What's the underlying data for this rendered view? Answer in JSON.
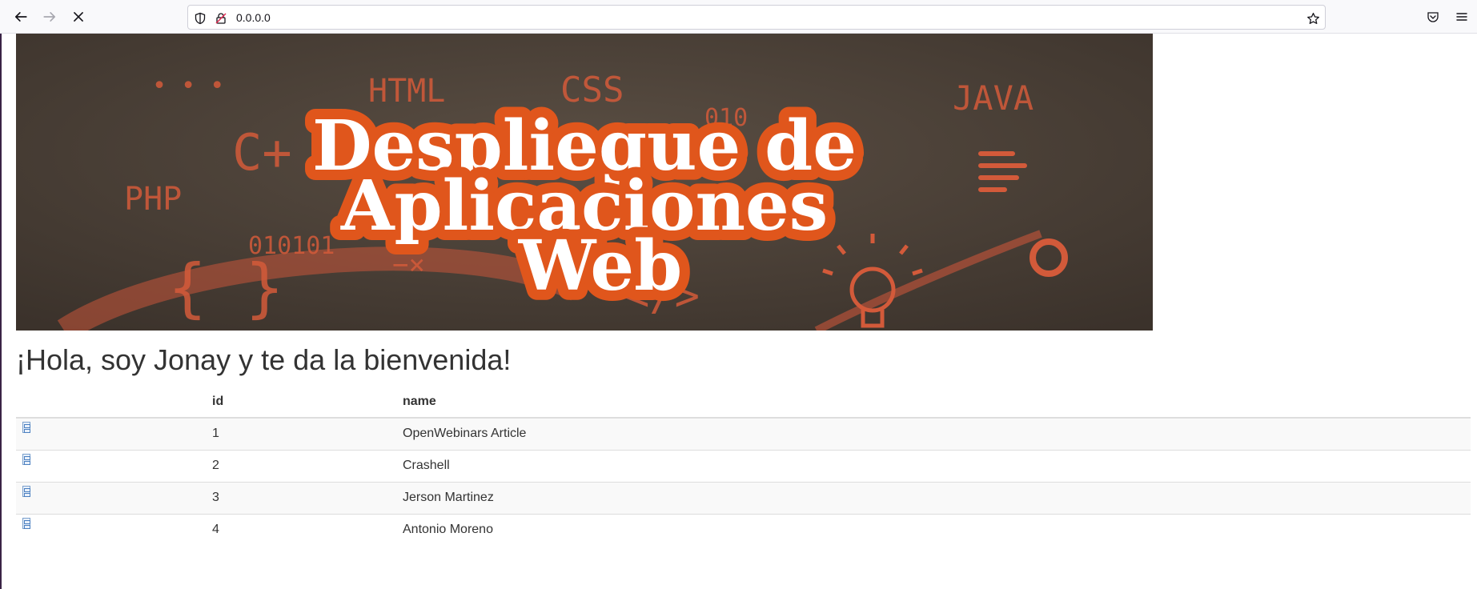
{
  "browser": {
    "url": "0.0.0.0"
  },
  "banner": {
    "title_line1": "Despliegue de",
    "title_line2": "Aplicaciones",
    "title_line3": "Web",
    "deco": {
      "html": "HTML",
      "css": "CSS",
      "java": "JAVA",
      "cplus": "C+",
      "php": "PHP",
      "binary": "010101",
      "braces": "{ }",
      "tag": "</>",
      "dots": "• • •",
      "minusx": "−×",
      "zero_one_zero": "010"
    },
    "colors": {
      "orange": "#e0561c",
      "background": "#4a4037"
    }
  },
  "page": {
    "welcome": "¡Hola, soy Jonay y te da la bienvenida!"
  },
  "table": {
    "headers": [
      "",
      "id",
      "name"
    ],
    "rows": [
      {
        "id": "1",
        "name": "OpenWebinars Article"
      },
      {
        "id": "2",
        "name": "Crashell"
      },
      {
        "id": "3",
        "name": "Jerson Martinez"
      },
      {
        "id": "4",
        "name": "Antonio Moreno"
      }
    ]
  }
}
